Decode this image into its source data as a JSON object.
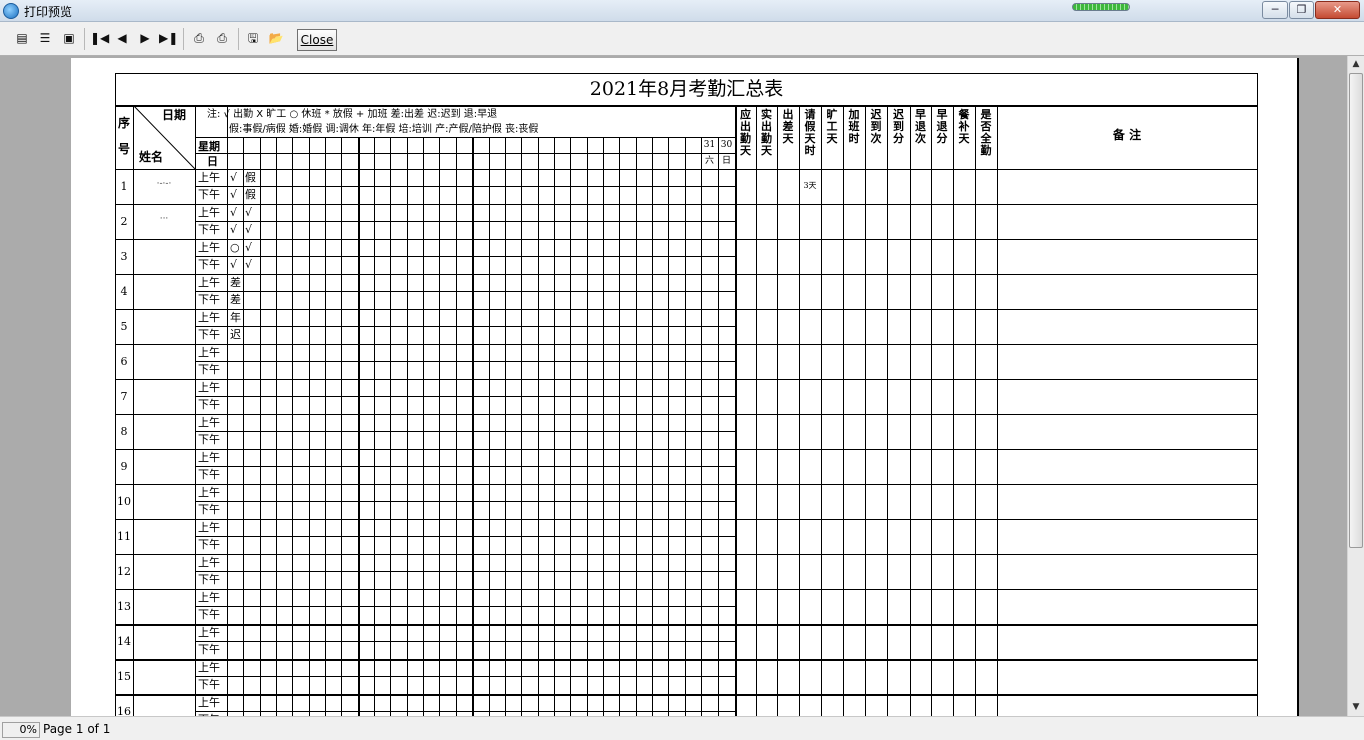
{
  "window": {
    "title": "打印预览"
  },
  "toolbar": {
    "close_label": "Close"
  },
  "status": {
    "zoom": "0%",
    "page": "Page 1 of 1"
  },
  "sheet": {
    "title": "2021年8月考勤汇总表",
    "col_seq": "序号",
    "col_date": "日期",
    "col_name": "姓名",
    "row_week": "星期",
    "row_day": "日",
    "legend_line1": "注: √ 出勤   X 旷工   ○ 休班   * 放假   + 加班   差:出差   迟:迟到   退:早退",
    "legend_line2": "假:事假/病假   婚:婚假   调:调休   年:年假   培:培训   产:产假/陪护假   丧:丧假",
    "day_31": "31",
    "day_30": "30",
    "week_31": "六",
    "week_30": "日",
    "summary_headers": [
      "应出勤天",
      "实出勤天",
      "出差天",
      "请假天时",
      "旷工天",
      "加班时",
      "迟到次",
      "迟到分",
      "早退次",
      "早退分",
      "餐补天",
      "是否全勤"
    ],
    "remarks_header": "备 注",
    "am": "上午",
    "pm": "下午",
    "rows": [
      {
        "no": "1",
        "name": "·-·-·",
        "marks": [
          "√",
          "假",
          "√",
          "假"
        ],
        "leave": "3天"
      },
      {
        "no": "2",
        "name": "···",
        "marks": [
          "√",
          "√",
          "√",
          "√"
        ],
        "leave": ""
      },
      {
        "no": "3",
        "name": "",
        "marks": [
          "○",
          "√",
          "√",
          "√"
        ],
        "leave": ""
      },
      {
        "no": "4",
        "name": "",
        "marks": [
          "差",
          "",
          "差",
          ""
        ],
        "leave": ""
      },
      {
        "no": "5",
        "name": "",
        "marks": [
          "年",
          "",
          "迟",
          ""
        ],
        "leave": ""
      },
      {
        "no": "6",
        "name": "",
        "marks": [
          "",
          "",
          "",
          ""
        ],
        "leave": ""
      },
      {
        "no": "7",
        "name": "",
        "marks": [
          "",
          "",
          "",
          ""
        ],
        "leave": ""
      },
      {
        "no": "8",
        "name": "",
        "marks": [
          "",
          "",
          "",
          ""
        ],
        "leave": ""
      },
      {
        "no": "9",
        "name": "",
        "marks": [
          "",
          "",
          "",
          ""
        ],
        "leave": ""
      },
      {
        "no": "10",
        "name": "",
        "marks": [
          "",
          "",
          "",
          ""
        ],
        "leave": ""
      },
      {
        "no": "11",
        "name": "",
        "marks": [
          "",
          "",
          "",
          ""
        ],
        "leave": ""
      },
      {
        "no": "12",
        "name": "",
        "marks": [
          "",
          "",
          "",
          ""
        ],
        "leave": ""
      },
      {
        "no": "13",
        "name": "",
        "marks": [
          "",
          "",
          "",
          ""
        ],
        "leave": ""
      },
      {
        "no": "14",
        "name": "",
        "marks": [
          "",
          "",
          "",
          ""
        ],
        "leave": ""
      },
      {
        "no": "15",
        "name": "",
        "marks": [
          "",
          "",
          "",
          ""
        ],
        "leave": ""
      },
      {
        "no": "16",
        "name": "",
        "marks": [
          "",
          "",
          "",
          ""
        ],
        "leave": ""
      }
    ]
  }
}
